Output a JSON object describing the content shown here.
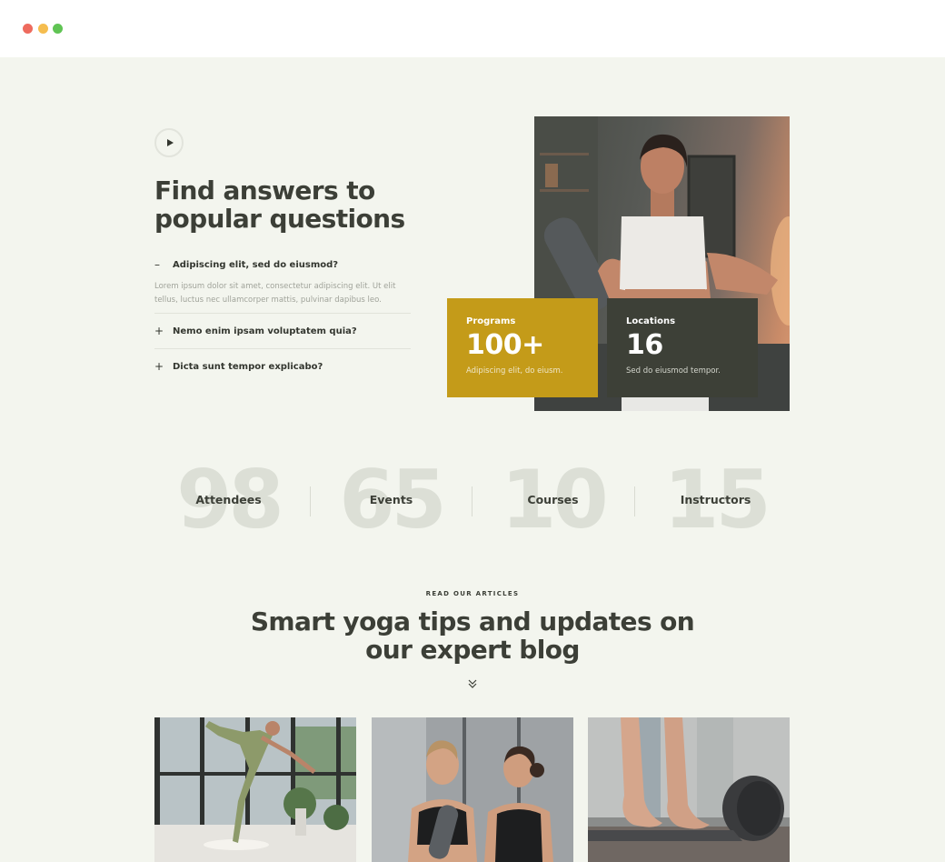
{
  "window": {
    "controls": [
      "close",
      "minimize",
      "maximize"
    ]
  },
  "faq": {
    "title": "Find answers to popular questions",
    "items": [
      {
        "sign": "–",
        "question": "Adipiscing elit, sed do eiusmod?",
        "answer": "Lorem ipsum dolor sit amet, consectetur adipiscing elit. Ut elit tellus, luctus nec ullamcorper mattis, pulvinar dapibus leo.",
        "expanded": true
      },
      {
        "sign": "+",
        "question": "Nemo enim ipsam voluptatem quia?",
        "expanded": false
      },
      {
        "sign": "+",
        "question": "Dicta sunt tempor explicabo?",
        "expanded": false
      }
    ]
  },
  "stats": [
    {
      "label": "Programs",
      "value": "100+",
      "desc": "Adipiscing elit, do eiusm."
    },
    {
      "label": "Locations",
      "value": "16",
      "desc": "Sed do eiusmod tempor."
    }
  ],
  "counters": [
    {
      "number": "98",
      "label": "Attendees"
    },
    {
      "number": "65",
      "label": "Events"
    },
    {
      "number": "10",
      "label": "Courses"
    },
    {
      "number": "15",
      "label": "Instructors"
    }
  ],
  "blog": {
    "eyebrow": "READ OUR ARTICLES",
    "title": "Smart yoga tips and updates on our expert blog"
  },
  "colors": {
    "background": "#f3f5ee",
    "accent_gold": "#c49b19",
    "dark_olive": "#3d4037",
    "text": "#3c3f37"
  },
  "icons": [
    "play-icon",
    "minus-icon",
    "plus-icon",
    "chevron-double-down-icon"
  ]
}
